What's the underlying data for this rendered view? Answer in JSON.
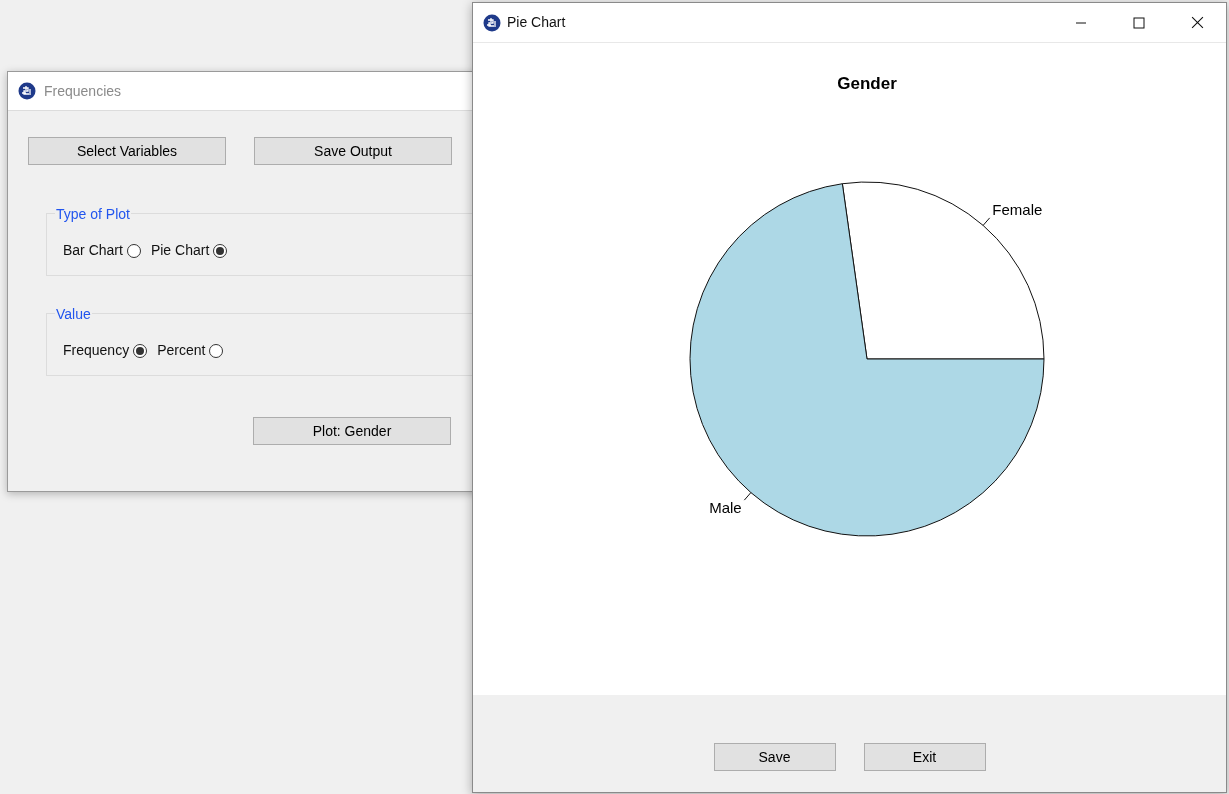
{
  "frequencies_window": {
    "title": "Frequencies",
    "top_buttons": [
      "Select Variables",
      "Save Output"
    ],
    "groups": [
      {
        "title": "Type of Plot",
        "options": [
          {
            "label": "Bar Chart",
            "selected": false
          },
          {
            "label": "Pie Chart",
            "selected": true
          }
        ]
      },
      {
        "title": "Value",
        "options": [
          {
            "label": "Frequency",
            "selected": true
          },
          {
            "label": "Percent",
            "selected": false
          }
        ]
      }
    ],
    "plot_button": "Plot: Gender"
  },
  "pie_chart_window": {
    "title": "Pie Chart",
    "plot_title": "Gender",
    "slice_labels": [
      "Female",
      "Male"
    ],
    "buttons": [
      "Save",
      "Exit"
    ]
  }
}
